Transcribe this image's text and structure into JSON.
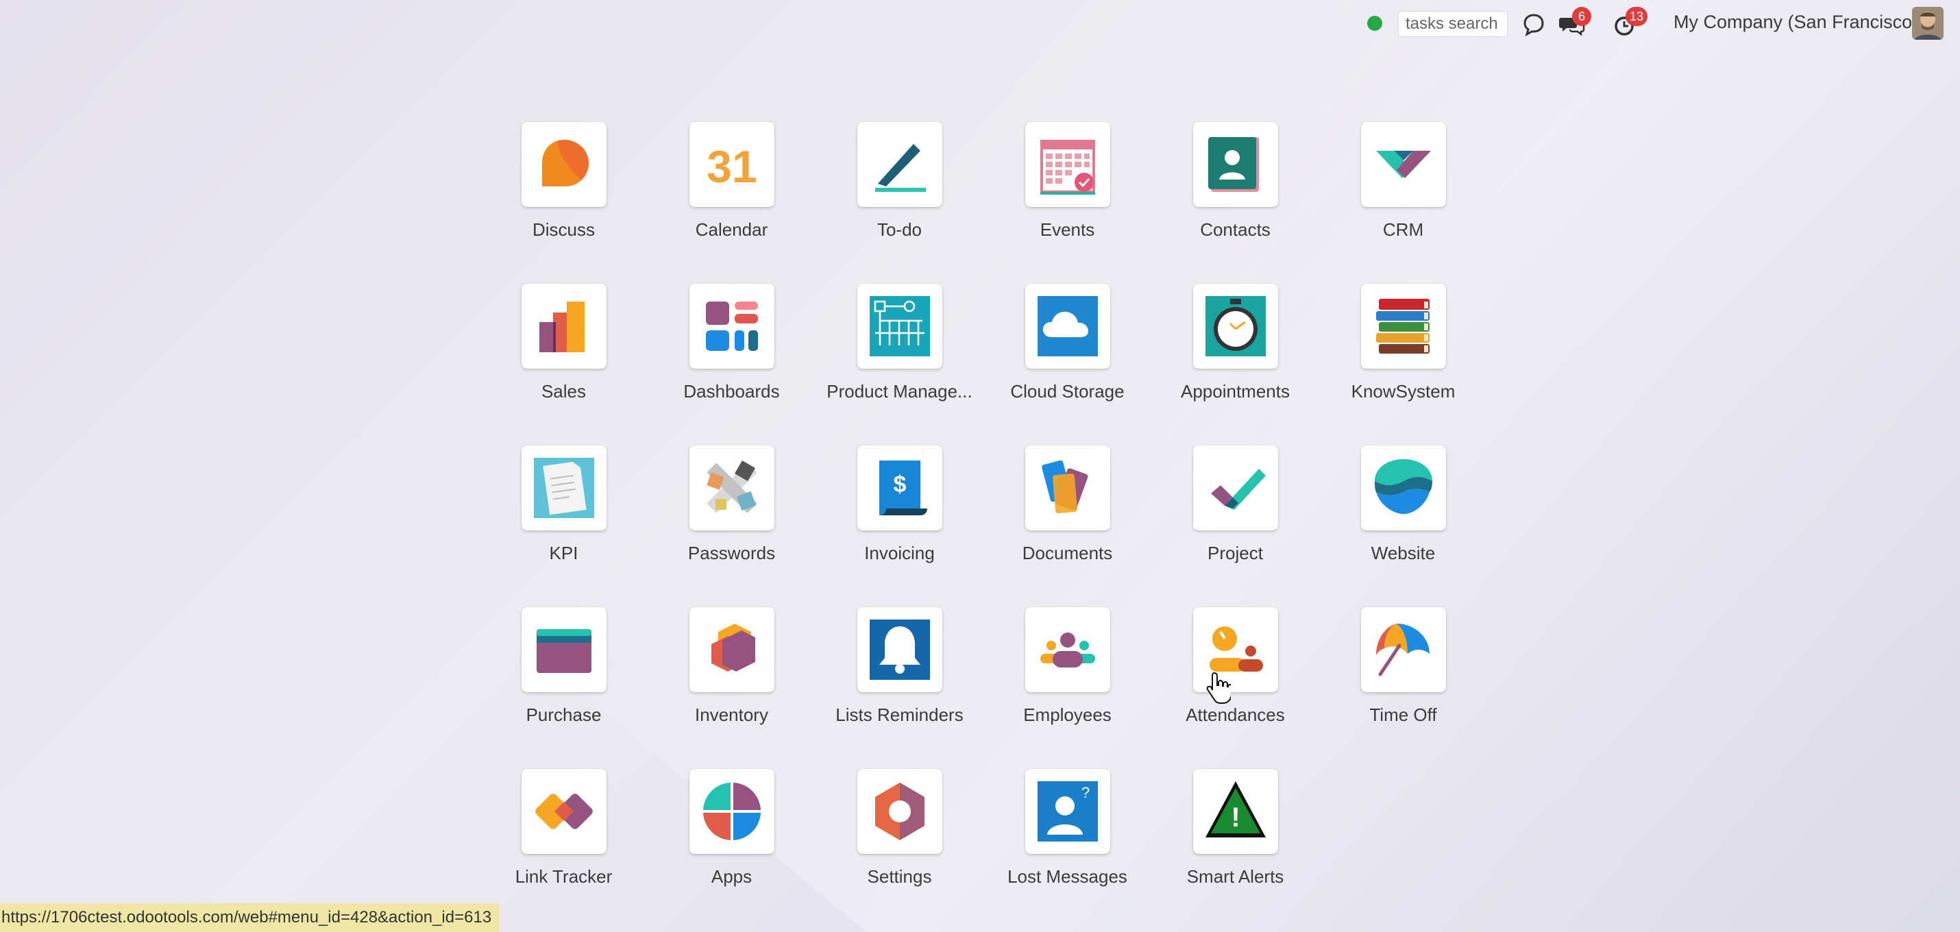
{
  "topbar": {
    "search_placeholder": "tasks search",
    "messages_badge": "6",
    "activities_badge": "13",
    "company": "My Company (San Francisco)"
  },
  "apps": [
    {
      "label": "Discuss",
      "icon": "discuss-icon"
    },
    {
      "label": "Calendar",
      "icon": "calendar-icon",
      "glyph": "31"
    },
    {
      "label": "To-do",
      "icon": "todo-icon"
    },
    {
      "label": "Events",
      "icon": "events-icon"
    },
    {
      "label": "Contacts",
      "icon": "contacts-icon"
    },
    {
      "label": "CRM",
      "icon": "crm-icon"
    },
    {
      "label": "Sales",
      "icon": "sales-icon"
    },
    {
      "label": "Dashboards",
      "icon": "dashboards-icon"
    },
    {
      "label": "Product Manage...",
      "icon": "product-management-icon"
    },
    {
      "label": "Cloud Storage",
      "icon": "cloud-storage-icon"
    },
    {
      "label": "Appointments",
      "icon": "appointments-icon"
    },
    {
      "label": "KnowSystem",
      "icon": "knowsystem-icon"
    },
    {
      "label": "KPI",
      "icon": "kpi-icon"
    },
    {
      "label": "Passwords",
      "icon": "passwords-icon"
    },
    {
      "label": "Invoicing",
      "icon": "invoicing-icon",
      "glyph": "$"
    },
    {
      "label": "Documents",
      "icon": "documents-icon"
    },
    {
      "label": "Project",
      "icon": "project-icon"
    },
    {
      "label": "Website",
      "icon": "website-icon"
    },
    {
      "label": "Purchase",
      "icon": "purchase-icon"
    },
    {
      "label": "Inventory",
      "icon": "inventory-icon"
    },
    {
      "label": "Lists Reminders",
      "icon": "lists-reminders-icon"
    },
    {
      "label": "Employees",
      "icon": "employees-icon"
    },
    {
      "label": "Attendances",
      "icon": "attendances-icon"
    },
    {
      "label": "Time Off",
      "icon": "time-off-icon"
    },
    {
      "label": "Link Tracker",
      "icon": "link-tracker-icon"
    },
    {
      "label": "Apps",
      "icon": "apps-icon"
    },
    {
      "label": "Settings",
      "icon": "settings-icon"
    },
    {
      "label": "Lost Messages",
      "icon": "lost-messages-icon",
      "glyph": "?"
    },
    {
      "label": "Smart Alerts",
      "icon": "smart-alerts-icon",
      "glyph": "!"
    }
  ],
  "statusbar": {
    "url": "https://1706ctest.odootools.com/web#menu_id=428&action_id=613"
  },
  "colors": {
    "badge": "#e03c3c",
    "status_online": "#28a745",
    "statusbar_bg": "#efe7a6"
  }
}
